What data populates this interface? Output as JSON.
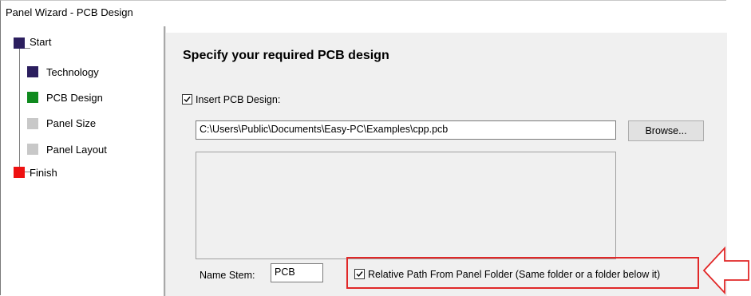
{
  "window": {
    "title": "Panel Wizard - PCB Design"
  },
  "steps": [
    {
      "label": "Start",
      "color": "#2b1e5e"
    },
    {
      "label": "Technology",
      "color": "#2b1e5e"
    },
    {
      "label": "PCB Design",
      "color": "#0f8a1e"
    },
    {
      "label": "Panel Size",
      "color": "#c8c8c8"
    },
    {
      "label": "Panel Layout",
      "color": "#c8c8c8"
    },
    {
      "label": "Finish",
      "color": "#ee1111"
    }
  ],
  "main": {
    "heading": "Specify your required PCB design",
    "insert_pcb_checkbox": {
      "label": "Insert PCB Design:",
      "checked": true
    },
    "pcb_path": "C:\\Users\\Public\\Documents\\Easy-PC\\Examples\\cpp.pcb",
    "browse_label": "Browse...",
    "name_stem_label": "Name Stem:",
    "name_stem_value": "PCB",
    "relative_path_checkbox": {
      "label": "Relative Path From Panel Folder (Same folder or a folder below it)",
      "checked": true
    }
  },
  "annotation": {
    "highlight_color": "#e12828",
    "arrow_icon": "left-arrow-icon"
  }
}
